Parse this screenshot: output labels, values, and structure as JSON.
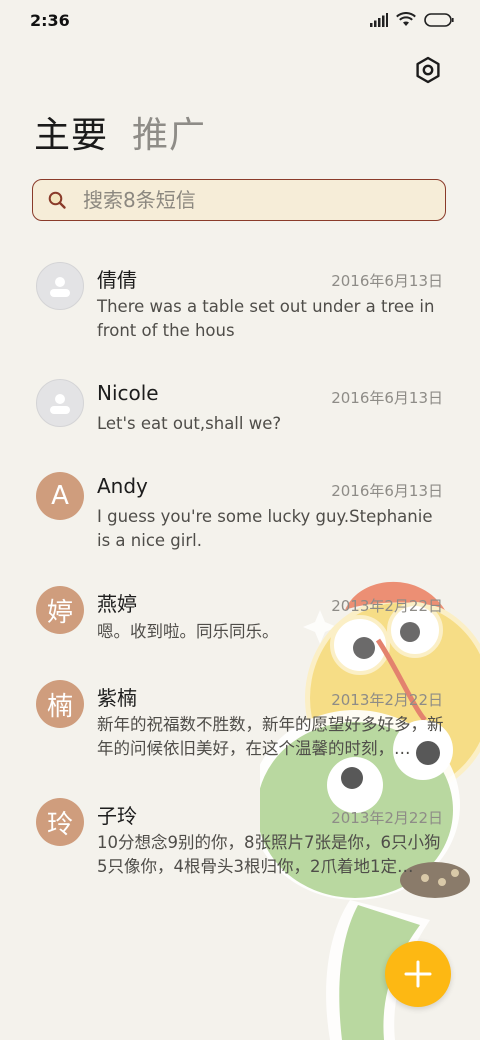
{
  "status": {
    "time": "2:36"
  },
  "tabs": [
    {
      "label": "主要",
      "active": true
    },
    {
      "label": "推广",
      "active": false
    }
  ],
  "search": {
    "placeholder": "搜索8条短信"
  },
  "threads": [
    {
      "name": "倩倩",
      "date": "2016年6月13日",
      "preview": "There was a table set out under a tree in front of the hous",
      "avatar": {
        "type": "person-icon",
        "letter": ""
      }
    },
    {
      "name": "Nicole",
      "date": "2016年6月13日",
      "preview": "Let's eat out,shall we?",
      "avatar": {
        "type": "person-icon",
        "letter": ""
      }
    },
    {
      "name": "Andy",
      "date": "2016年6月13日",
      "preview": "I guess you're some lucky guy.Stephanie is a nice girl.",
      "avatar": {
        "type": "letter",
        "letter": "A"
      }
    },
    {
      "name": "燕婷",
      "date": "2013年2月22日",
      "preview": "嗯。收到啦。同乐同乐。",
      "avatar": {
        "type": "letter",
        "letter": "婷"
      }
    },
    {
      "name": "紫楠",
      "date": "2013年2月22日",
      "preview": "新年的祝福数不胜数，新年的愿望好多好多，新年的问候依旧美好，在这个温馨的时刻，…",
      "avatar": {
        "type": "letter",
        "letter": "楠"
      }
    },
    {
      "name": "子玲",
      "date": "2013年2月22日",
      "preview": "10分想念9别的你，8张照片7张是你，6只小狗5只像你，4根骨头3根归你，2爪着地1定…",
      "avatar": {
        "type": "letter",
        "letter": "玲"
      }
    }
  ],
  "fab": {
    "icon": "plus-icon"
  },
  "colors": {
    "background": "#f4f2ec",
    "accent": "#fdb813",
    "avatar_tan": "#cf9d7d",
    "search_border": "#8a3b2a"
  }
}
